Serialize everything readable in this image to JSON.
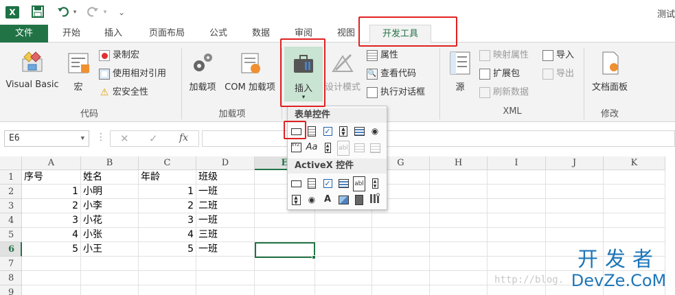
{
  "app": {
    "logo_letter": "X",
    "window_title": "测试",
    "accent_color": "#217346"
  },
  "quick_access": {
    "save_icon": "save-icon",
    "undo_icon": "undo-icon",
    "redo_icon": "redo-icon",
    "customize_icon": "customize-icon"
  },
  "tabs": {
    "file": "文件",
    "home": "开始",
    "insert": "插入",
    "page_layout": "页面布局",
    "formulas": "公式",
    "data": "数据",
    "review": "审阅",
    "view": "视图",
    "developer": "开发工具"
  },
  "ribbon": {
    "code": {
      "label": "代码",
      "visual_basic": "Visual Basic",
      "macros": "宏",
      "record_macro": "录制宏",
      "relative_refs": "使用相对引用",
      "macro_security": "宏安全性"
    },
    "addins": {
      "label": "加载项",
      "addins": "加载项",
      "com_addins": "COM 加载项"
    },
    "controls": {
      "insert": "插入",
      "design_mode": "设计模式",
      "properties": "属性",
      "view_code": "查看代码",
      "run_dialog": "执行对话框"
    },
    "xml": {
      "label": "XML",
      "source": "源",
      "map_properties": "映射属性",
      "expansion_packs": "扩展包",
      "refresh_data": "刷新数据",
      "import": "导入",
      "export": "导出"
    },
    "modify": {
      "label": "修改",
      "document_panel": "文档面板"
    }
  },
  "formula_bar": {
    "name_box": "E6",
    "cancel_symbol": "✕",
    "enter_symbol": "✓",
    "fx_symbol": "fx",
    "formula": ""
  },
  "dropdown": {
    "form_controls_title": "表单控件",
    "activex_title": "ActiveX 控件",
    "label_a": "Aa",
    "label_abl": "abl",
    "label_a_small": "A",
    "xyz": "XYZ"
  },
  "sheet": {
    "columns": [
      "A",
      "B",
      "C",
      "D",
      "E",
      "F",
      "G",
      "H",
      "I",
      "J",
      "K"
    ],
    "rows": [
      "1",
      "2",
      "3",
      "4",
      "5",
      "6",
      "7",
      "8",
      "9"
    ],
    "header_row": [
      "序号",
      "姓名",
      "年龄",
      "班级"
    ],
    "data_rows": [
      [
        "1",
        "小明",
        "1",
        "一班"
      ],
      [
        "2",
        "小李",
        "2",
        "二班"
      ],
      [
        "3",
        "小花",
        "3",
        "一班"
      ],
      [
        "4",
        "小张",
        "4",
        "三班"
      ],
      [
        "5",
        "小王",
        "5",
        "一班"
      ]
    ]
  },
  "watermark": {
    "url": "http://blog.",
    "brand_cn": "开发者",
    "brand_en": "DevZe.CoM"
  }
}
